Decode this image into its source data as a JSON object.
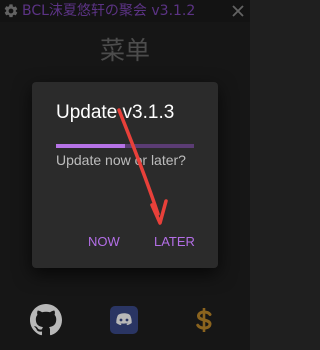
{
  "titlebar": {
    "title": "BCL沫夏悠轩の聚会 v3.1.2",
    "settings_icon": "gear-icon",
    "close_icon": "close-icon"
  },
  "page": {
    "title": "菜单"
  },
  "dialog": {
    "title": "Update v3.1.3",
    "message": "Update now or later?",
    "progress": 0.5,
    "buttons": {
      "now": "NOW",
      "later": "LATER"
    }
  },
  "bottom_bar": {
    "items": [
      {
        "icon": "github-icon"
      },
      {
        "icon": "discord-icon"
      },
      {
        "icon": "dollar-icon"
      }
    ]
  },
  "colors": {
    "background": "#1f1f1f",
    "accent": "#b36ee6",
    "title_accent": "#7f47b8",
    "arrow": "#e8403a",
    "discord": "#3b4a8a",
    "dollar": "#c0892a"
  }
}
